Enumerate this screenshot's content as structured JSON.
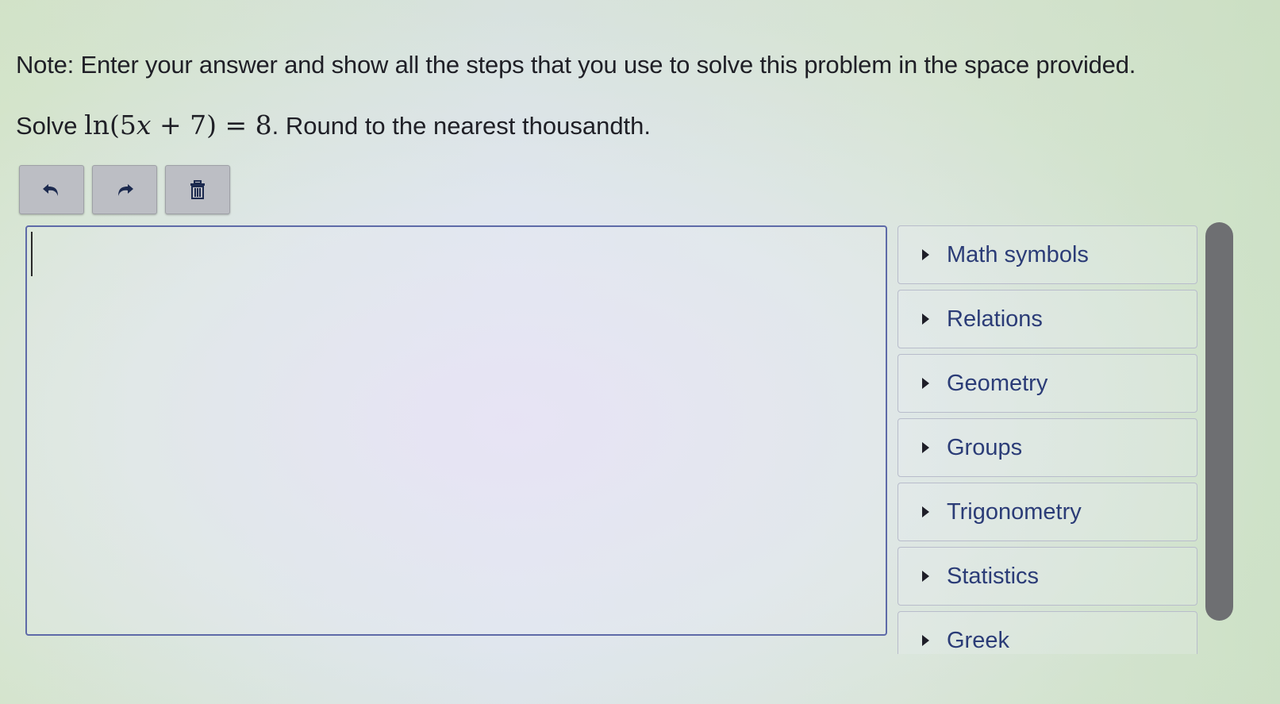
{
  "note": "Note: Enter your answer and show all the steps that you use to solve this problem in the space provided.",
  "problem": {
    "prefix": "Solve",
    "fn": "ln",
    "open": "(5",
    "var": "x",
    "rest": " + 7) = 8",
    "suffix": ". Round to the nearest thousandth."
  },
  "toolbar": {
    "buttons": [
      {
        "name": "undo",
        "icon": "undo-icon"
      },
      {
        "name": "redo",
        "icon": "redo-icon"
      },
      {
        "name": "clear",
        "icon": "trash-icon"
      }
    ]
  },
  "editor": {
    "value": ""
  },
  "palette": {
    "items": [
      {
        "label": "Math symbols"
      },
      {
        "label": "Relations"
      },
      {
        "label": "Geometry"
      },
      {
        "label": "Groups"
      },
      {
        "label": "Trigonometry"
      },
      {
        "label": "Statistics"
      },
      {
        "label": "Greek"
      }
    ]
  }
}
